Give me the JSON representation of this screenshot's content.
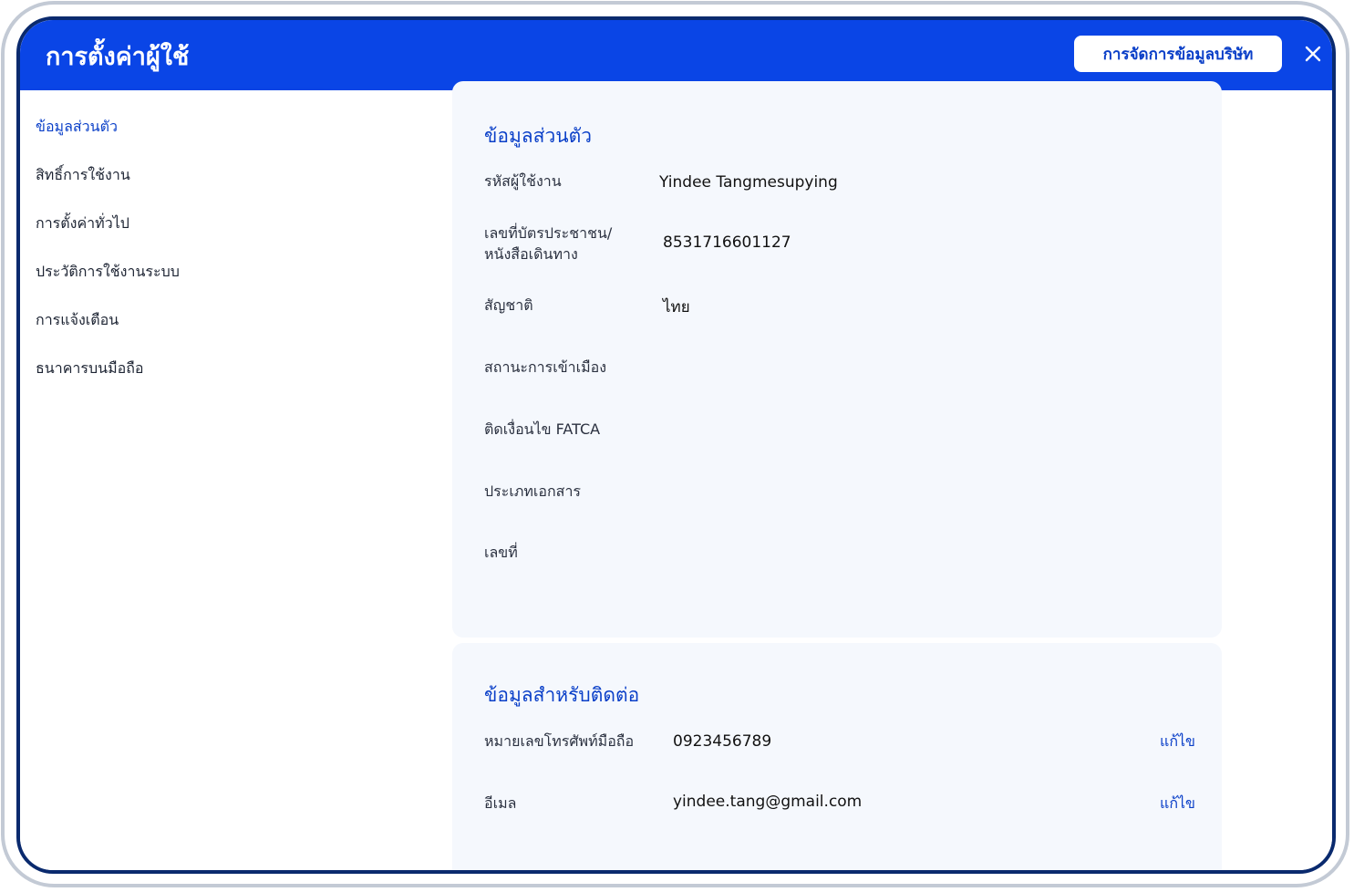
{
  "header": {
    "title": "การตั้งค่าผู้ใช้",
    "company_button": "การจัดการข้อมูลบริษัท",
    "close_icon": "close-icon"
  },
  "colors": {
    "header_bg": "#0a45e6",
    "accent": "#0a3fc8",
    "card_bg": "#f5f8fd"
  },
  "sidebar": {
    "items": [
      {
        "label": "ข้อมูลส่วนตัว",
        "active": true
      },
      {
        "label": "สิทธิ์การใช้งาน"
      },
      {
        "label": "การตั้งค่าทั่วไป"
      },
      {
        "label": "ประวัติการใช้งานระบบ"
      },
      {
        "label": "การแจ้งเตือน"
      },
      {
        "label": "ธนาคารบนมือถือ"
      }
    ]
  },
  "personal": {
    "title": "ข้อมูลส่วนตัว",
    "rows": [
      {
        "label": "รหัสผู้ใช้งาน",
        "value": "Yindee Tangmesupying"
      },
      {
        "label_line1": "เลขที่บัตรประชาชน/",
        "label_line2": "หนังสือเดินทาง",
        "value": "8531716601127"
      },
      {
        "label": "สัญชาติ",
        "value": "ไทย"
      },
      {
        "label": "สถานะการเข้าเมือง",
        "value": ""
      },
      {
        "label": "ติดเงื่อนไข FATCA",
        "value": ""
      },
      {
        "label": "ประเภทเอกสาร",
        "value": ""
      },
      {
        "label": "เลขที่",
        "value": ""
      }
    ]
  },
  "contact": {
    "title": "ข้อมูลสำหรับติดต่อ",
    "rows": [
      {
        "label": "หมายเลขโทรศัพท์มือถือ",
        "value": "0923456789",
        "edit": "แก้ไข"
      },
      {
        "label": "อีเมล",
        "value": "yindee.tang@gmail.com",
        "edit": "แก้ไข"
      }
    ]
  }
}
